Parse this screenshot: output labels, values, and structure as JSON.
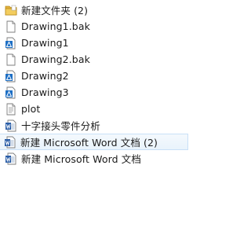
{
  "files": [
    {
      "name": "新建文件夹 (2)",
      "icon": "folder-icon",
      "type": "folder"
    },
    {
      "name": "Drawing1.bak",
      "icon": "document-icon",
      "type": "blank"
    },
    {
      "name": "Drawing1",
      "icon": "dwg-icon",
      "type": "dwg"
    },
    {
      "name": "Drawing2.bak",
      "icon": "document-icon",
      "type": "blank"
    },
    {
      "name": "Drawing2",
      "icon": "dwg-icon",
      "type": "dwg"
    },
    {
      "name": "Drawing3",
      "icon": "dwg-icon",
      "type": "dwg"
    },
    {
      "name": "plot",
      "icon": "text-document-icon",
      "type": "text"
    },
    {
      "name": "十字接头零件分析",
      "icon": "word-document-icon",
      "type": "word"
    },
    {
      "name": "新建 Microsoft Word 文档 (2)",
      "icon": "word-document-icon",
      "type": "word",
      "hovered": true
    },
    {
      "name": "新建 Microsoft Word 文档",
      "icon": "word-document-icon",
      "type": "word"
    }
  ],
  "colors": {
    "hover_bg": "#e9f3fc",
    "hover_border": "#c9e0f7",
    "folder": "#e8b93e",
    "dwg_blue": "#1e6fc4",
    "word_blue": "#2b5ea7"
  }
}
